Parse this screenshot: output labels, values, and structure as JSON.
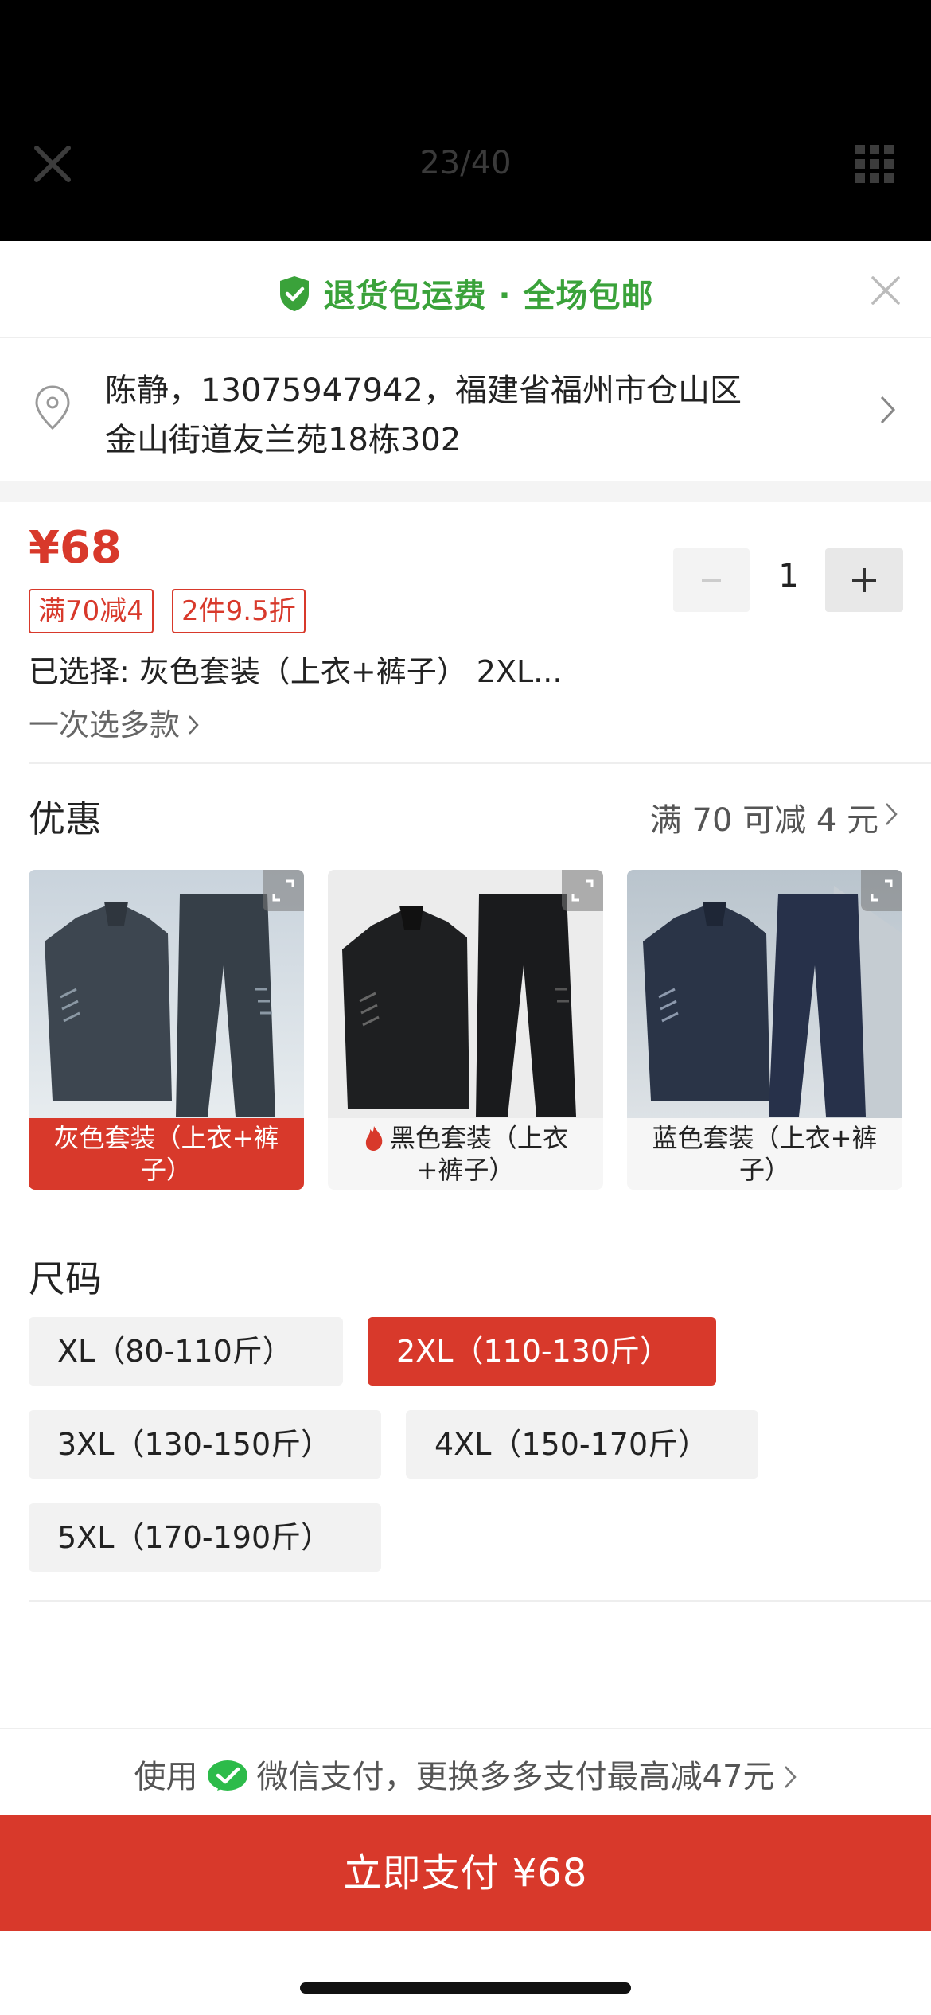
{
  "topbar": {
    "counter": "23/40"
  },
  "banner": {
    "text": "退货包运费 · 全场包邮"
  },
  "address": {
    "line1": "陈静，13075947942，福建省福州市仓山区",
    "line2": "金山街道友兰苑18栋302"
  },
  "product": {
    "price": "¥68",
    "tags": [
      "满70减4",
      "2件9.5折"
    ],
    "selected": "已选择: 灰色套装（上衣+裤子） 2XL...",
    "multi_select": "一次选多款",
    "quantity": "1"
  },
  "promo": {
    "title": "优惠",
    "value": "满 70 可减 4 元"
  },
  "variants": [
    {
      "label": "灰色套装（上衣+裤子）",
      "selected": true
    },
    {
      "label": "黑色套装（上衣+裤子）",
      "hot": true
    },
    {
      "label": "蓝色套装（上衣+裤子）"
    }
  ],
  "sizes": {
    "title": "尺码",
    "options": [
      "XL（80-110斤）",
      "2XL（110-130斤）",
      "3XL（130-150斤）",
      "4XL（150-170斤）",
      "5XL（170-190斤）"
    ],
    "selected_index": 1
  },
  "payment": {
    "prefix": "使用",
    "text": "微信支付，更换多多支付最高减47元",
    "button": "立即支付 ¥68"
  },
  "colors": {
    "accent": "#d8392b",
    "green": "#3aa23a",
    "wechat": "#2dbb4a"
  }
}
